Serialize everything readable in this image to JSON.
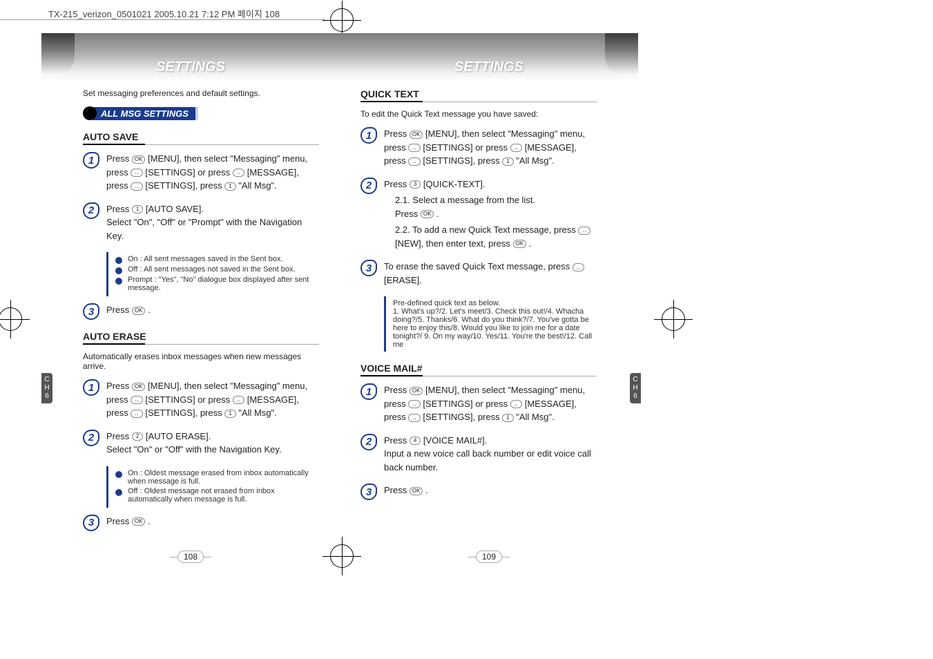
{
  "header": "TX-215_verizon_0501021  2005.10.21  7:12 PM  페이지 108",
  "banner_title": "SETTINGS",
  "chapter_tab": "C\nH\n6",
  "left": {
    "intro": "Set messaging preferences and default settings.",
    "pill": "ALL MSG SETTINGS",
    "sections": [
      {
        "title": "AUTO SAVE",
        "steps": [
          {
            "n": "1",
            "text_parts": [
              "Press ",
              "OK",
              " [MENU], then select \"Messaging\" menu, press ",
              "⟨⟩",
              " [SETTINGS] or press ",
              "⟨⟩",
              " [MESSAGE], press ",
              "⟨⟩",
              " [SETTINGS], press ",
              "1",
              " \"All Msg\"."
            ]
          },
          {
            "n": "2",
            "text_parts": [
              "Press ",
              "1",
              " [AUTO SAVE].\nSelect \"On\", \"Off\" or \"Prompt\" with the Navigation Key."
            ],
            "notes": [
              "On : All sent messages saved in the Sent box.",
              "Off : All sent messages not saved in the Sent box.",
              "Prompt : \"Yes\", \"No\" dialogue box displayed after sent message."
            ]
          },
          {
            "n": "3",
            "text_parts": [
              "Press ",
              "OK",
              " ."
            ]
          }
        ]
      },
      {
        "title": "AUTO ERASE",
        "intro": "Automatically erases inbox messages when new messages arrive.",
        "steps": [
          {
            "n": "1",
            "text_parts": [
              "Press ",
              "OK",
              " [MENU], then select \"Messaging\" menu, press ",
              "⟨⟩",
              " [SETTINGS] or press ",
              "⟨⟩",
              " [MESSAGE], press ",
              "⟨⟩",
              " [SETTINGS], press ",
              "1",
              " \"All Msg\"."
            ]
          },
          {
            "n": "2",
            "text_parts": [
              "Press ",
              "2",
              " [AUTO ERASE].\nSelect \"On\" or \"Off\" with the Navigation Key."
            ],
            "notes": [
              "On : Oldest message erased from inbox automatically when message is full.",
              "Off : Oldest message not erased from inbox automatically when message is full."
            ]
          },
          {
            "n": "3",
            "text_parts": [
              "Press ",
              "OK",
              " ."
            ]
          }
        ]
      }
    ],
    "page_number": "108"
  },
  "right": {
    "sections": [
      {
        "title": "QUICK TEXT",
        "intro": "To edit the Quick Text message you have saved:",
        "steps": [
          {
            "n": "1",
            "text_parts": [
              "Press ",
              "OK",
              " [MENU], then select \"Messaging\" menu, press ",
              "⟨⟩",
              " [SETTINGS] or press ",
              "⟨⟩",
              " [MESSAGE], press ",
              "⟨⟩",
              " [SETTINGS], press ",
              "1",
              " \"All Msg\"."
            ]
          },
          {
            "n": "2",
            "text_parts": [
              "Press ",
              "3",
              " [QUICK-TEXT]."
            ],
            "substeps": [
              {
                "label": "2.1.",
                "text_parts": [
                  "Select a message from the list.\nPress ",
                  "OK",
                  " ."
                ]
              },
              {
                "label": "2.2.",
                "text_parts": [
                  "To add a new Quick Text message, press ",
                  "⟨⟩",
                  " [NEW], then enter text, press ",
                  "OK",
                  " ."
                ]
              }
            ]
          },
          {
            "n": "3",
            "text_parts": [
              "To erase the saved Quick Text message, press ",
              "⟨⟩",
              " [ERASE]."
            ],
            "flat_note": "Pre-defined quick text as below.\n1. What's up?/2. Let's meet/3. Check this out!/4. Whacha doing?/5. Thanks/6. What do you think?/7. You've gotta be here to enjoy this/8. Would you like to join me for a date tonight?/ 9. On my way/10. Yes/11. You're the best!/12. Call me"
          }
        ]
      },
      {
        "title": "VOICE MAIL#",
        "steps": [
          {
            "n": "1",
            "text_parts": [
              "Press ",
              "OK",
              " [MENU], then select \"Messaging\" menu, press ",
              "⟨⟩",
              " [SETTINGS] or press ",
              "⟨⟩",
              " [MESSAGE], press ",
              "⟨⟩",
              " [SETTINGS], press ",
              "1",
              " \"All Msg\"."
            ]
          },
          {
            "n": "2",
            "text_parts": [
              "Press ",
              "4",
              " [VOICE MAIL#].\nInput a new voice call back number or edit voice call back number."
            ]
          },
          {
            "n": "3",
            "text_parts": [
              "Press ",
              "OK",
              " ."
            ]
          }
        ]
      }
    ],
    "page_number": "109"
  }
}
